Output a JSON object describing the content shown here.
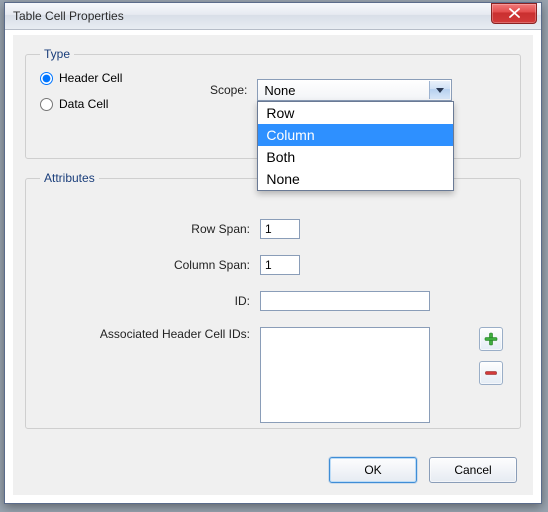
{
  "window": {
    "title": "Table Cell Properties"
  },
  "type_group": {
    "legend": "Type",
    "header_cell": "Header Cell",
    "data_cell": "Data Cell",
    "selected": "header"
  },
  "scope": {
    "label": "Scope:",
    "value": "None",
    "options": [
      "Row",
      "Column",
      "Both",
      "None"
    ],
    "highlighted": "Column"
  },
  "attributes_group": {
    "legend": "Attributes",
    "row_span_label": "Row Span:",
    "row_span_value": "1",
    "col_span_label": "Column Span:",
    "col_span_value": "1",
    "id_label": "ID:",
    "id_value": "",
    "assoc_label": "Associated Header Cell IDs:"
  },
  "buttons": {
    "ok": "OK",
    "cancel": "Cancel"
  }
}
